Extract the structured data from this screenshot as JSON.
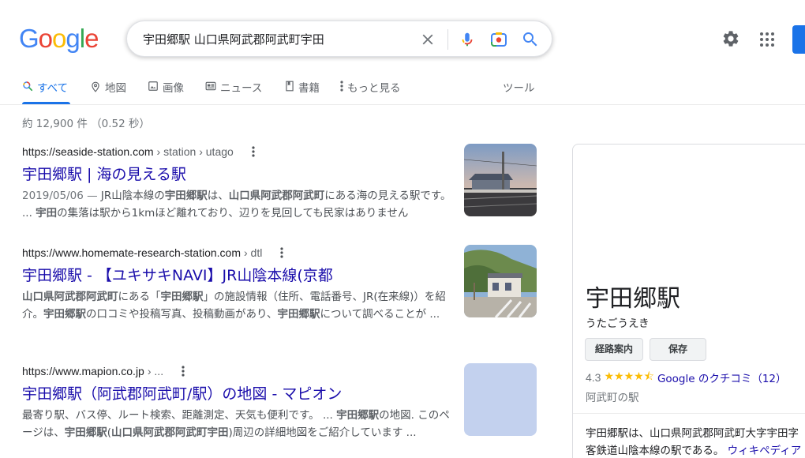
{
  "header": {
    "logo_letters": [
      {
        "ch": "G",
        "color": "#4285f4"
      },
      {
        "ch": "o",
        "color": "#ea4335"
      },
      {
        "ch": "o",
        "color": "#fbbc05"
      },
      {
        "ch": "g",
        "color": "#4285f4"
      },
      {
        "ch": "l",
        "color": "#34a853"
      },
      {
        "ch": "e",
        "color": "#ea4335"
      }
    ],
    "search_query": "宇田郷駅 山口県阿武郡阿武町宇田",
    "accent_color": "#1a73e8"
  },
  "tabs": [
    {
      "label": "すべて",
      "icon": "search-icon",
      "active": true
    },
    {
      "label": "地図",
      "icon": "map-pin-icon"
    },
    {
      "label": "画像",
      "icon": "image-icon"
    },
    {
      "label": "ニュース",
      "icon": "news-icon"
    },
    {
      "label": "書籍",
      "icon": "book-icon"
    },
    {
      "label": "もっと見る",
      "icon": "more-vert-icon"
    }
  ],
  "tools_label": "ツール",
  "result_stats": "約 12,900 件 （0.52 秒）",
  "results": [
    {
      "url": "https://seaside-station.com",
      "path": "› station › utago",
      "title": "宇田郷駅 | 海の見える駅",
      "snippet_html": "<span class=\"date\">2019/05/06 — </span>JR山陰本線の<b>宇田郷駅</b>は、<b>山口県阿武郡阿武町</b>にある海の見える駅です。 ... <b>宇田</b>の集落は駅から1kmほど離れており、辺りを見回しても民家はありません"
    },
    {
      "url": "https://www.homemate-research-station.com",
      "path": "› dtl",
      "title": "宇田郷駅 - 【ユキサキNAVI】JR山陰本線(京都",
      "snippet_html": "<b>山口県阿武郡阿武町</b>にある「<b>宇田郷駅</b>」の施設情報（住所、電話番号、JR(在来線)）を紹介。<b>宇田郷駅</b>の口コミや投稿写真、投稿動画があり、<b>宇田郷駅</b>について調べることが ..."
    },
    {
      "url": "https://www.mapion.co.jp",
      "path": "› ...",
      "title": "宇田郷駅（阿武郡阿武町/駅）の地図 - マピオン",
      "snippet_html": "最寄り駅、バス停、ルート検索、距離測定、天気も便利です。 ... <b>宇田郷駅</b>の地図. このページは、<b>宇田郷駅</b>(<b>山口県阿武郡阿武町宇田</b>)周辺の詳細地図をご紹介しています ..."
    }
  ],
  "knowledge_panel": {
    "title": "宇田郷駅",
    "reading": "うたごうえき",
    "directions_label": "経路案内",
    "save_label": "保存",
    "rating": "4.3",
    "rating_value": 4.3,
    "stars": "★★★★⯪",
    "reviews_link": "Google のクチコミ（12）",
    "type": "阿武町の駅",
    "desc_line1": "宇田郷駅は、山口県阿武郡阿武町大字宇田字",
    "desc_line2": "客鉄道山陰本線の駅である。",
    "wiki_link": "ウィキペディア"
  }
}
